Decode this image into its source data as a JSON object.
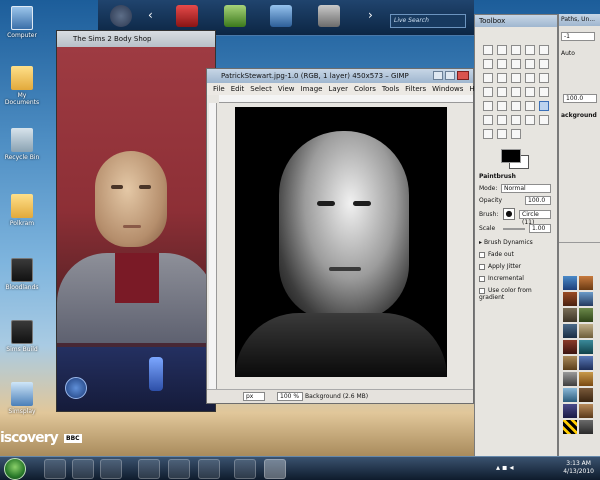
{
  "desktop": {
    "icons": [
      {
        "label": "Computer",
        "glyph": "computer-icon"
      },
      {
        "label": "My Documents",
        "glyph": "folder-icon"
      },
      {
        "label": "Recycle Bin",
        "glyph": "recycle-bin-icon"
      },
      {
        "label": "Polkram",
        "glyph": "folder-icon"
      },
      {
        "label": "Bloodlands",
        "glyph": "game-icon"
      },
      {
        "label": "Sims Build",
        "glyph": "game-icon"
      },
      {
        "label": "Simsplay",
        "glyph": "network-icon"
      }
    ],
    "watermark_brand": "iscovery",
    "watermark_badge": "BBC"
  },
  "topbar": {
    "live_search_placeholder": "Live Search",
    "colors": {
      "bg": "#0c2644",
      "accent": "#4a78a8"
    }
  },
  "sims_window": {
    "title": "The Sims 2 Body Shop"
  },
  "gimp_image_window": {
    "title": "PatrickStewart.jpg-1.0 (RGB, 1 layer) 450x573 – GIMP",
    "menu": [
      "File",
      "Edit",
      "Select",
      "View",
      "Image",
      "Layer",
      "Colors",
      "Tools",
      "Filters",
      "Windows",
      "Help"
    ],
    "status": {
      "unit": "px",
      "zoom": "100 %",
      "info": "Background (2.6 MB)"
    }
  },
  "toolbox": {
    "title": "Toolbox",
    "tool_name": "Paintbrush",
    "mode_label": "Mode:",
    "mode_value": "Normal",
    "opacity_label": "Opacity",
    "opacity_value": "100.0",
    "brush_label": "Brush:",
    "brush_value": "Circle (11)",
    "scale_label": "Scale",
    "scale_value": "1.00",
    "brush_dynamics": "Brush Dynamics",
    "fade_out": "Fade out",
    "apply_jitter": "Apply Jitter",
    "incremental": "Incremental",
    "use_gradient": "Use color from gradient"
  },
  "layers_panel": {
    "title": "Paths, Un...",
    "tab_value": "-1",
    "auto_label": "Auto",
    "value_100": "100.0",
    "layer_name": "ackground"
  },
  "taskbar": {
    "time": "3:13 AM",
    "date": "4/13/2010"
  }
}
